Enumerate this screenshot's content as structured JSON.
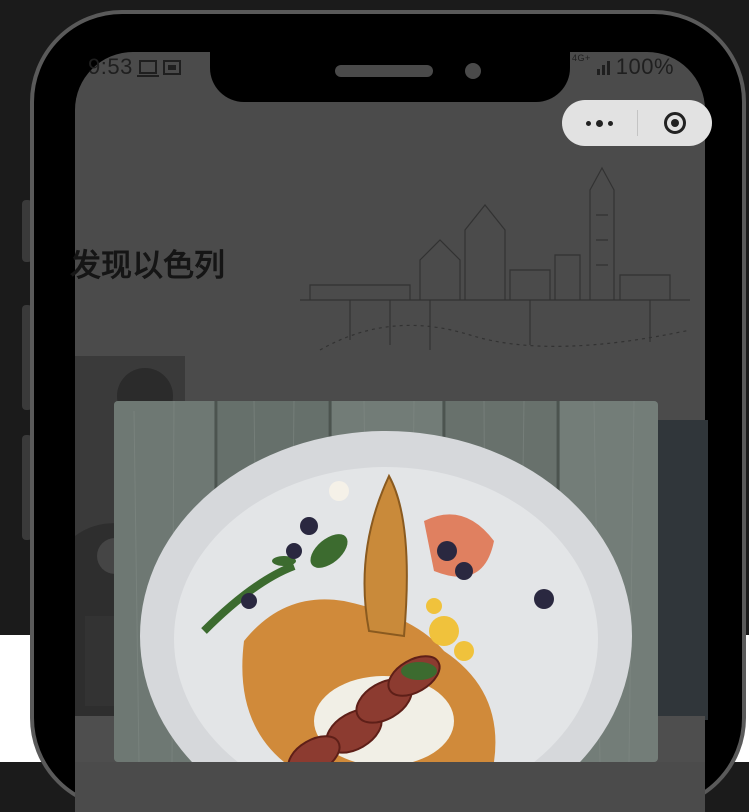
{
  "status_bar": {
    "time": "9:53",
    "network_tag": "4G+",
    "battery": "100%"
  },
  "capsule": {
    "more_icon": "more-dots-icon",
    "close_icon": "target-close-icon"
  },
  "page": {
    "title": "发现以色列"
  },
  "popup": {
    "image": "plated-dish-photo"
  },
  "colors": {
    "overlay_screen": "#4b4b4b",
    "capsule_bg": "#e2e2e2",
    "title_text": "#151515",
    "outer_background": "#1b1b1b"
  }
}
